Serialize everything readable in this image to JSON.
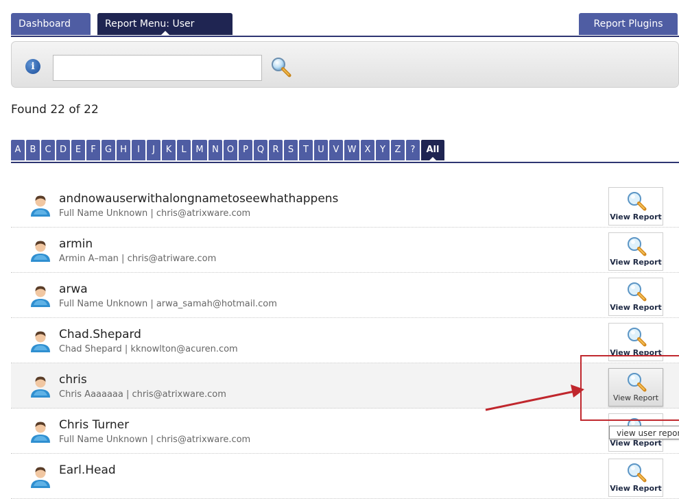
{
  "tabs": {
    "dashboard": "Dashboard",
    "active": "Report Menu: User",
    "plugins": "Report Plugins"
  },
  "search": {
    "value": "",
    "placeholder": ""
  },
  "found_text": "Found 22 of 22",
  "letters": [
    "A",
    "B",
    "C",
    "D",
    "E",
    "F",
    "G",
    "H",
    "I",
    "J",
    "K",
    "L",
    "M",
    "N",
    "O",
    "P",
    "Q",
    "R",
    "S",
    "T",
    "U",
    "V",
    "W",
    "X",
    "Y",
    "Z",
    "?",
    "All"
  ],
  "active_letter": "All",
  "view_report_label": "View Report",
  "users": [
    {
      "name": "andnowauserwithalongnametoseewhathappens",
      "sub": "Full Name Unknown | chris@atrixware.com"
    },
    {
      "name": "armin",
      "sub": "Armin A–man | chris@atriware.com"
    },
    {
      "name": "arwa",
      "sub": "Full Name Unknown | arwa_samah@hotmail.com"
    },
    {
      "name": "Chad.Shepard",
      "sub": "Chad Shepard | kknowlton@acuren.com"
    },
    {
      "name": "chris",
      "sub": "Chris Aaaaaaa | chris@atrixware.com"
    },
    {
      "name": "Chris Turner",
      "sub": "Full Name Unknown | chris@atrixware.com"
    },
    {
      "name": "Earl.Head",
      "sub": ""
    }
  ],
  "tooltip": "view user report",
  "colors": {
    "tab": "#4f5da3",
    "tab_active": "#1f2552",
    "annotation": "#c0272d"
  }
}
